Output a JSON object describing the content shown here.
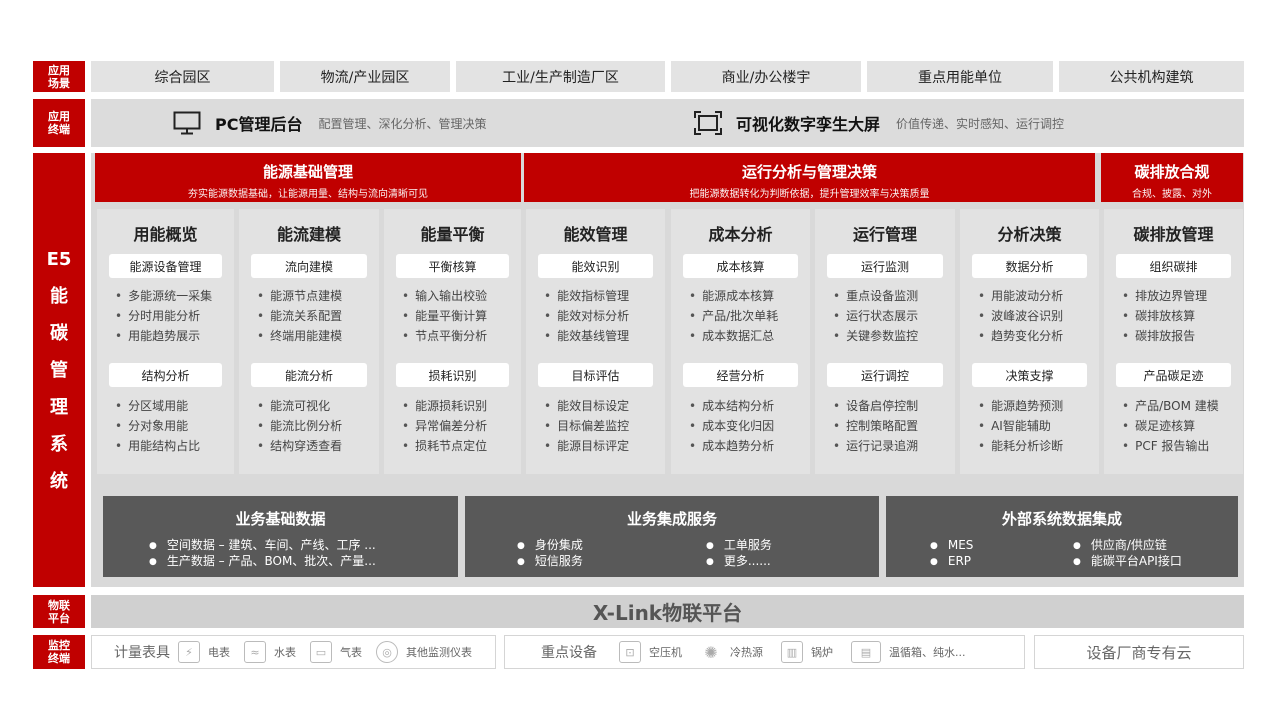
{
  "side_labels": {
    "scene": [
      "应用",
      "场景"
    ],
    "terminal": [
      "应用",
      "终端"
    ],
    "system": [
      "E5",
      "能",
      "碳",
      "管",
      "理",
      "系",
      "统"
    ],
    "iot": [
      "物联",
      "平台"
    ],
    "monitor": [
      "监控",
      "终端"
    ]
  },
  "scenes": [
    "综合园区",
    "物流/产业园区",
    "工业/生产制造厂区",
    "商业/办公楼宇",
    "重点用能单位",
    "公共机构建筑"
  ],
  "terminals": [
    {
      "icon": "monitor-icon",
      "title": "PC管理后台",
      "desc": "配置管理、深化分析、管理决策"
    },
    {
      "icon": "screen-icon",
      "title": "可视化数字孪生大屏",
      "desc": "价值传递、实时感知、运行调控"
    }
  ],
  "categories": [
    {
      "title": "能源基础管理",
      "subtitle": "夯实能源数据基础，让能源用量、结构与流向清晰可见"
    },
    {
      "title": "运行分析与管理决策",
      "subtitle": "把能源数据转化为判断依据，提升管理效率与决策质量"
    },
    {
      "title": "碳排放合规",
      "subtitle": "合规、披露、对外"
    }
  ],
  "modules": [
    {
      "title": "用能概览",
      "pill1": "能源设备管理",
      "list1": [
        "多能源统一采集",
        "分时用能分析",
        "用能趋势展示"
      ],
      "pill2": "结构分析",
      "list2": [
        "分区域用能",
        "分对象用能",
        "用能结构占比"
      ]
    },
    {
      "title": "能流建模",
      "pill1": "流向建模",
      "list1": [
        "能源节点建模",
        "能流关系配置",
        "终端用能建模"
      ],
      "pill2": "能流分析",
      "list2": [
        "能流可视化",
        "能流比例分析",
        "结构穿透查看"
      ]
    },
    {
      "title": "能量平衡",
      "pill1": "平衡核算",
      "list1": [
        "输入输出校验",
        "能量平衡计算",
        "节点平衡分析"
      ],
      "pill2": "损耗识别",
      "list2": [
        "能源损耗识别",
        "异常偏差分析",
        "损耗节点定位"
      ]
    },
    {
      "title": "能效管理",
      "pill1": "能效识别",
      "list1": [
        "能效指标管理",
        "能效对标分析",
        "能效基线管理"
      ],
      "pill2": "目标评估",
      "list2": [
        "能效目标设定",
        "目标偏差监控",
        "能源目标评定"
      ]
    },
    {
      "title": "成本分析",
      "pill1": "成本核算",
      "list1": [
        "能源成本核算",
        "产品/批次单耗",
        "成本数据汇总"
      ],
      "pill2": "经营分析",
      "list2": [
        "成本结构分析",
        "成本变化归因",
        "成本趋势分析"
      ]
    },
    {
      "title": "运行管理",
      "pill1": "运行监测",
      "list1": [
        "重点设备监测",
        "运行状态展示",
        "关键参数监控"
      ],
      "pill2": "运行调控",
      "list2": [
        "设备启停控制",
        "控制策略配置",
        "运行记录追溯"
      ]
    },
    {
      "title": "分析决策",
      "pill1": "数据分析",
      "list1": [
        "用能波动分析",
        "波峰波谷识别",
        "趋势变化分析"
      ],
      "pill2": "决策支撑",
      "list2": [
        "能源趋势预测",
        "AI智能辅助",
        "能耗分析诊断"
      ]
    },
    {
      "title": "碳排放管理",
      "pill1": "组织碳排",
      "list1": [
        "排放边界管理",
        "碳排放核算",
        "碳排放报告"
      ],
      "pill2": "产品碳足迹",
      "list2": [
        "产品/BOM 建模",
        "碳足迹核算",
        "PCF 报告输出"
      ]
    }
  ],
  "data_boxes": [
    {
      "title": "业务基础数据",
      "items": [
        "空间数据 – 建筑、车间、产线、工序 ...",
        "生产数据 – 产品、BOM、批次、产量..."
      ]
    },
    {
      "title": "业务集成服务",
      "items": [
        "身份集成",
        "短信服务",
        "工单服务",
        "更多......"
      ]
    },
    {
      "title": "外部系统数据集成",
      "items": [
        "MES",
        "ERP",
        "供应商/供应链",
        "能碳平台API接口"
      ]
    }
  ],
  "iot_platform": "X-Link物联平台",
  "monitor": {
    "meters": {
      "title": "计量表具",
      "items": [
        {
          "icon": "electric-meter-icon",
          "label": "电表"
        },
        {
          "icon": "water-meter-icon",
          "label": "水表"
        },
        {
          "icon": "gas-meter-icon",
          "label": "气表"
        },
        {
          "icon": "other-meter-icon",
          "label": "其他监测仪表"
        }
      ]
    },
    "equipment": {
      "title": "重点设备",
      "items": [
        {
          "icon": "air-compressor-icon",
          "label": "空压机"
        },
        {
          "icon": "hvac-icon",
          "label": "冷热源"
        },
        {
          "icon": "boiler-icon",
          "label": "锅炉"
        },
        {
          "icon": "kiln-icon",
          "label": "温循箱、纯水..."
        }
      ]
    },
    "cloud": {
      "title": "设备厂商专有云"
    }
  },
  "colors": {
    "accent": "#c00000",
    "panel": "#d9d9d9",
    "dark_box": "#595959"
  }
}
